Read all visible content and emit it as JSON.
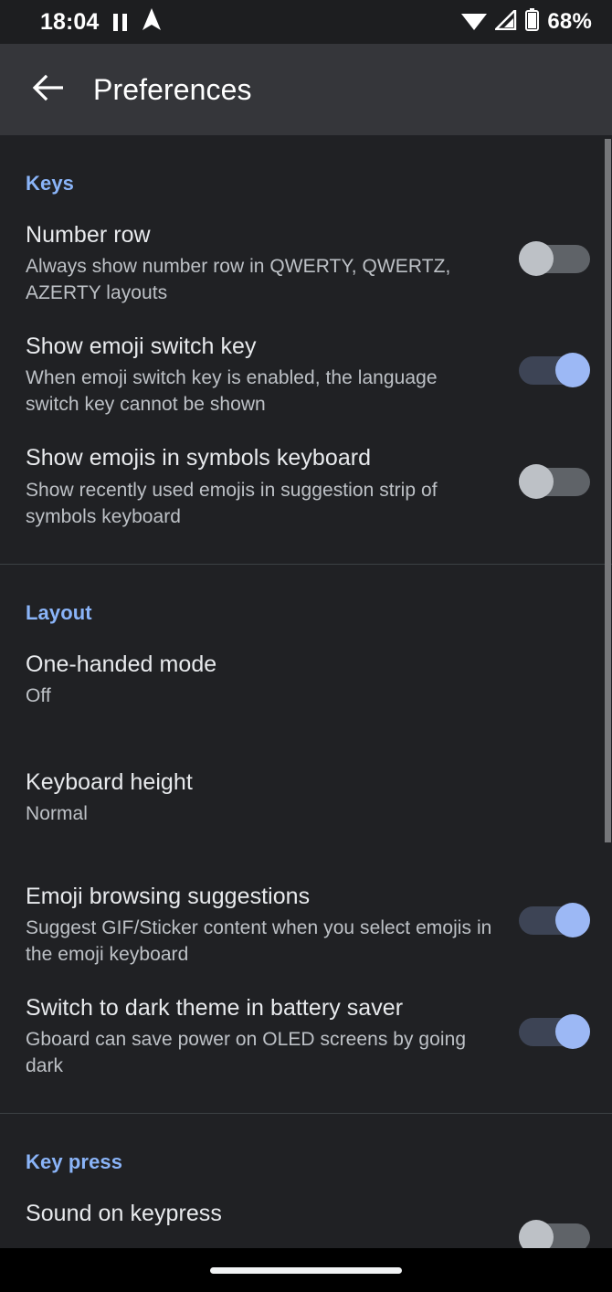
{
  "status_bar": {
    "clock": "18:04",
    "battery_percent": "68%",
    "icons": [
      "pause-icon",
      "navigation-arrow-icon",
      "wifi-icon",
      "cellular-signal-icon",
      "battery-icon"
    ]
  },
  "app_bar": {
    "back_icon": "arrow-back-icon",
    "title": "Preferences"
  },
  "colors": {
    "accent": "#8ab4f8",
    "switch_on_thumb": "#9cb8f5",
    "switch_on_track": "#3d4455",
    "switch_off_thumb": "#bdc1c6",
    "switch_off_track": "#5f6368",
    "background": "#202124",
    "app_bar": "#35363a",
    "status_bar": "#1d1e20",
    "title_text": "#e8eaed",
    "summary_text": "#bdc1c6",
    "divider": "#3c4043"
  },
  "sections": [
    {
      "header": "Keys",
      "items": [
        {
          "title": "Number row",
          "summary": "Always show number row in QWERTY, QWERTZ, AZERTY layouts",
          "control": "switch",
          "state": "off"
        },
        {
          "title": "Show emoji switch key",
          "summary": "When emoji switch key is enabled, the language switch key cannot be shown",
          "control": "switch",
          "state": "on"
        },
        {
          "title": "Show emojis in symbols keyboard",
          "summary": "Show recently used emojis in suggestion strip of symbols keyboard",
          "control": "switch",
          "state": "off"
        }
      ]
    },
    {
      "header": "Layout",
      "items": [
        {
          "title": "One-handed mode",
          "summary": "Off",
          "control": "none",
          "state": ""
        },
        {
          "title": "Keyboard height",
          "summary": "Normal",
          "control": "none",
          "state": ""
        },
        {
          "title": "Emoji browsing suggestions",
          "summary": "Suggest GIF/Sticker content when you select emojis in the emoji keyboard",
          "control": "switch",
          "state": "on"
        },
        {
          "title": "Switch to dark theme in battery saver",
          "summary": "Gboard can save power on OLED screens by going dark",
          "control": "switch",
          "state": "on"
        }
      ]
    },
    {
      "header": "Key press",
      "items": [
        {
          "title": "Sound on keypress",
          "summary": "",
          "control": "switch",
          "state": "off"
        }
      ]
    }
  ]
}
